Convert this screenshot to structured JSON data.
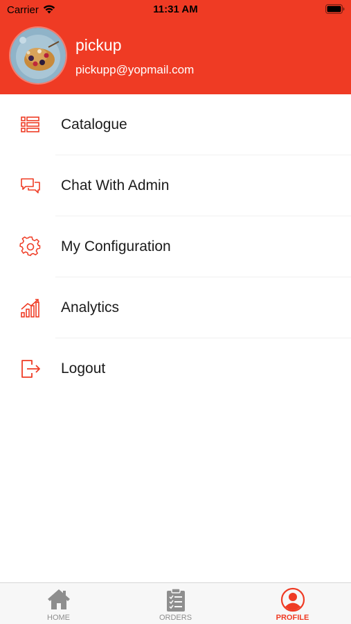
{
  "status_bar": {
    "carrier": "Carrier",
    "time": "11:31 AM"
  },
  "profile": {
    "name": "pickup",
    "email": "pickupp@yopmail.com"
  },
  "menu": [
    {
      "label": "Catalogue",
      "icon": "list-icon"
    },
    {
      "label": "Chat With Admin",
      "icon": "chat-icon"
    },
    {
      "label": "My Configuration",
      "icon": "gear-icon"
    },
    {
      "label": "Analytics",
      "icon": "chart-icon"
    },
    {
      "label": "Logout",
      "icon": "logout-icon"
    }
  ],
  "tabs": [
    {
      "label": "HOME",
      "icon": "home-icon",
      "active": false
    },
    {
      "label": "ORDERS",
      "icon": "clipboard-icon",
      "active": false
    },
    {
      "label": "PROFILE",
      "icon": "profile-icon",
      "active": true
    }
  ],
  "colors": {
    "accent": "#ef3b24",
    "inactive_tab": "#8e8e8e"
  }
}
